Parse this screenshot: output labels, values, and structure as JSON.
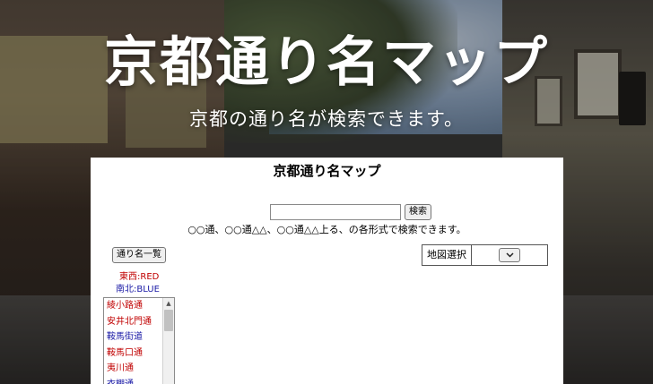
{
  "hero": {
    "title": "京都通り名マップ",
    "subtitle": "京都の通り名が検索できます。"
  },
  "app": {
    "title": "京都通り名マップ",
    "search": {
      "value": "",
      "placeholder": "",
      "button_label": "検索"
    },
    "hint": "○○通、○○通△△、○○通△△上る、の各形式で検索できます。",
    "street_list_button": "通り名一覧",
    "map_select": {
      "label": "地図選択",
      "selected": "",
      "chevron_icon": "chevron-down-icon"
    },
    "legend": {
      "east_west": "東西:RED",
      "north_south": "南北:BLUE",
      "colors": {
        "east_west": "#c00000",
        "north_south": "#1a1aa6"
      }
    },
    "streets": [
      {
        "name": "綾小路通",
        "dir": "ew"
      },
      {
        "name": "安井北門通",
        "dir": "ew"
      },
      {
        "name": "鞍馬街道",
        "dir": "ns"
      },
      {
        "name": "鞍馬口通",
        "dir": "ew"
      },
      {
        "name": "夷川通",
        "dir": "ew"
      },
      {
        "name": "衣棚通",
        "dir": "ns"
      }
    ]
  }
}
